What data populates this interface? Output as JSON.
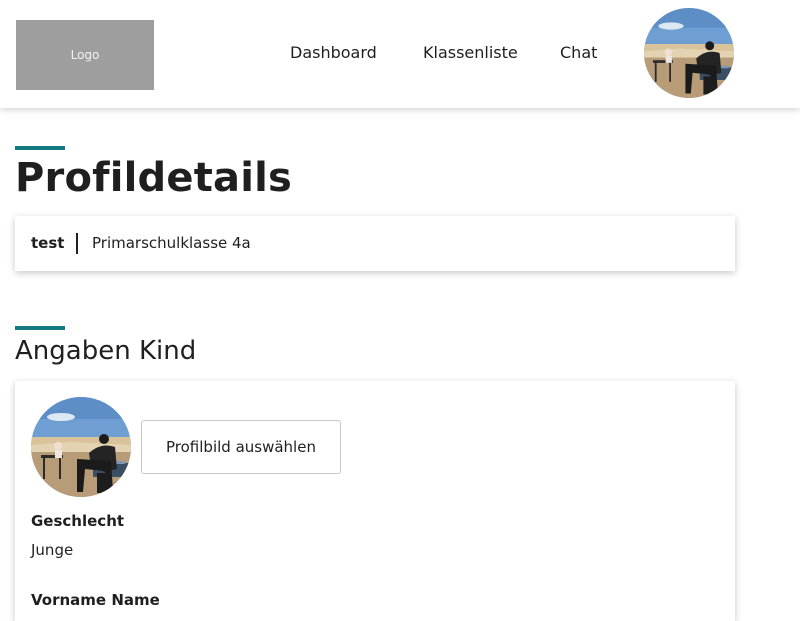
{
  "header": {
    "logo_text": "Logo",
    "nav": [
      {
        "label": "Dashboard"
      },
      {
        "label": "Klassenliste"
      },
      {
        "label": "Chat"
      }
    ]
  },
  "main": {
    "page_title": "Profildetails",
    "profile": {
      "name": "test",
      "class_name": "Primarschulklasse 4a"
    },
    "child_section": {
      "title": "Angaben Kind",
      "select_photo_label": "Profilbild auswählen",
      "fields": [
        {
          "label": "Geschlecht",
          "value": "Junge"
        },
        {
          "label": "Vorname Name"
        }
      ]
    }
  },
  "colors": {
    "accent": "#137a82",
    "logo_background": "#9e9e9e"
  }
}
